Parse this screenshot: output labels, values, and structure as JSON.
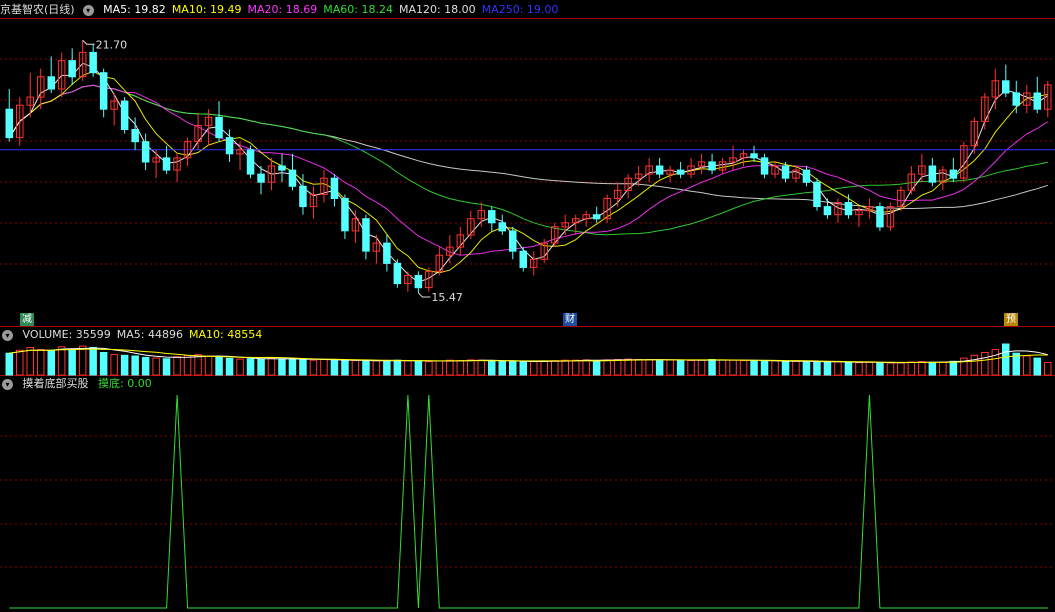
{
  "stock": {
    "name": "京基智农",
    "period": "(日线)"
  },
  "ma_legend": [
    {
      "label": "MA5: 19.82",
      "color": "#ffffff"
    },
    {
      "label": "MA10: 19.49",
      "color": "#ffff00"
    },
    {
      "label": "MA20: 18.69",
      "color": "#ff33ff"
    },
    {
      "label": "MA60: 18.24",
      "color": "#33dd33"
    },
    {
      "label": "MA120: 18.00",
      "color": "#dddddd"
    },
    {
      "label": "MA250: 19.00",
      "color": "#3333ff"
    }
  ],
  "volume_legend": [
    {
      "label": "VOLUME: 35599",
      "color": "#dddddd"
    },
    {
      "label": "MA5: 44896",
      "color": "#dddddd"
    },
    {
      "label": "MA10: 48554",
      "color": "#ffff00"
    }
  ],
  "indicator": {
    "name": "摸着底部买股",
    "series_label": "摸底: 0.00",
    "color": "#33dd33"
  },
  "price_labels": {
    "high": "21.70",
    "low": "15.47"
  },
  "events": [
    {
      "label": "减",
      "color": "#2e8b57"
    },
    {
      "label": "财",
      "color": "#1e4f9e"
    },
    {
      "label": "预",
      "color": "#b8860b"
    }
  ],
  "colors": {
    "up": "#ff3232",
    "down": "#54ffff",
    "grid": "#8b0000",
    "background": "#000000"
  },
  "chart_data": [
    {
      "type": "candlestick",
      "title": "京基智农 (日线)",
      "ylim": [
        15.0,
        22.2
      ],
      "ma_levels": {
        "MA5": 19.82,
        "MA10": 19.49,
        "MA20": 18.69,
        "MA60": 18.24,
        "MA120": 18.0,
        "MA250": 19.0
      },
      "high_marker": 21.7,
      "low_marker": 15.47,
      "candles": [
        {
          "o": 20.0,
          "h": 20.5,
          "l": 19.2,
          "c": 19.3
        },
        {
          "o": 19.3,
          "h": 20.3,
          "l": 19.1,
          "c": 20.1
        },
        {
          "o": 20.1,
          "h": 20.9,
          "l": 19.8,
          "c": 20.3
        },
        {
          "o": 20.3,
          "h": 21.0,
          "l": 20.0,
          "c": 20.8
        },
        {
          "o": 20.8,
          "h": 21.3,
          "l": 20.4,
          "c": 20.5
        },
        {
          "o": 20.5,
          "h": 21.4,
          "l": 20.3,
          "c": 21.2
        },
        {
          "o": 21.2,
          "h": 21.5,
          "l": 20.6,
          "c": 20.8
        },
        {
          "o": 20.8,
          "h": 21.7,
          "l": 20.7,
          "c": 21.4
        },
        {
          "o": 21.4,
          "h": 21.6,
          "l": 20.8,
          "c": 20.9
        },
        {
          "o": 20.9,
          "h": 21.0,
          "l": 19.8,
          "c": 20.0
        },
        {
          "o": 20.0,
          "h": 20.4,
          "l": 19.6,
          "c": 20.2
        },
        {
          "o": 20.2,
          "h": 20.3,
          "l": 19.4,
          "c": 19.5
        },
        {
          "o": 19.5,
          "h": 19.8,
          "l": 19.0,
          "c": 19.2
        },
        {
          "o": 19.2,
          "h": 19.4,
          "l": 18.5,
          "c": 18.7
        },
        {
          "o": 18.7,
          "h": 19.0,
          "l": 18.3,
          "c": 18.8
        },
        {
          "o": 18.8,
          "h": 19.1,
          "l": 18.4,
          "c": 18.5
        },
        {
          "o": 18.5,
          "h": 18.9,
          "l": 18.2,
          "c": 18.8
        },
        {
          "o": 18.8,
          "h": 19.3,
          "l": 18.6,
          "c": 19.2
        },
        {
          "o": 19.2,
          "h": 19.9,
          "l": 19.0,
          "c": 19.6
        },
        {
          "o": 19.6,
          "h": 20.0,
          "l": 19.1,
          "c": 19.8
        },
        {
          "o": 19.8,
          "h": 20.2,
          "l": 19.2,
          "c": 19.3
        },
        {
          "o": 19.3,
          "h": 19.5,
          "l": 18.7,
          "c": 18.9
        },
        {
          "o": 18.9,
          "h": 19.2,
          "l": 18.5,
          "c": 19.0
        },
        {
          "o": 19.0,
          "h": 19.1,
          "l": 18.3,
          "c": 18.4
        },
        {
          "o": 18.4,
          "h": 18.6,
          "l": 17.9,
          "c": 18.2
        },
        {
          "o": 18.2,
          "h": 18.8,
          "l": 18.0,
          "c": 18.6
        },
        {
          "o": 18.6,
          "h": 18.9,
          "l": 18.2,
          "c": 18.5
        },
        {
          "o": 18.5,
          "h": 18.9,
          "l": 18.0,
          "c": 18.1
        },
        {
          "o": 18.1,
          "h": 18.4,
          "l": 17.4,
          "c": 17.6
        },
        {
          "o": 17.6,
          "h": 18.1,
          "l": 17.3,
          "c": 17.9
        },
        {
          "o": 17.9,
          "h": 18.5,
          "l": 17.7,
          "c": 18.3
        },
        {
          "o": 18.3,
          "h": 18.4,
          "l": 17.6,
          "c": 17.8
        },
        {
          "o": 17.8,
          "h": 17.9,
          "l": 16.8,
          "c": 17.0
        },
        {
          "o": 17.0,
          "h": 17.5,
          "l": 16.7,
          "c": 17.3
        },
        {
          "o": 17.3,
          "h": 17.4,
          "l": 16.3,
          "c": 16.5
        },
        {
          "o": 16.5,
          "h": 16.9,
          "l": 16.2,
          "c": 16.7
        },
        {
          "o": 16.7,
          "h": 16.9,
          "l": 16.0,
          "c": 16.2
        },
        {
          "o": 16.2,
          "h": 16.3,
          "l": 15.6,
          "c": 15.7
        },
        {
          "o": 15.7,
          "h": 16.0,
          "l": 15.5,
          "c": 15.9
        },
        {
          "o": 15.9,
          "h": 16.0,
          "l": 15.47,
          "c": 15.6
        },
        {
          "o": 15.6,
          "h": 16.1,
          "l": 15.5,
          "c": 16.0
        },
        {
          "o": 16.0,
          "h": 16.6,
          "l": 15.9,
          "c": 16.4
        },
        {
          "o": 16.4,
          "h": 16.9,
          "l": 16.2,
          "c": 16.6
        },
        {
          "o": 16.6,
          "h": 17.1,
          "l": 16.4,
          "c": 16.9
        },
        {
          "o": 16.9,
          "h": 17.5,
          "l": 16.8,
          "c": 17.3
        },
        {
          "o": 17.3,
          "h": 17.7,
          "l": 17.1,
          "c": 17.5
        },
        {
          "o": 17.5,
          "h": 17.6,
          "l": 17.0,
          "c": 17.2
        },
        {
          "o": 17.2,
          "h": 17.4,
          "l": 16.9,
          "c": 17.0
        },
        {
          "o": 17.0,
          "h": 17.1,
          "l": 16.3,
          "c": 16.5
        },
        {
          "o": 16.5,
          "h": 16.6,
          "l": 16.0,
          "c": 16.1
        },
        {
          "o": 16.1,
          "h": 16.5,
          "l": 15.9,
          "c": 16.3
        },
        {
          "o": 16.3,
          "h": 16.8,
          "l": 16.2,
          "c": 16.7
        },
        {
          "o": 16.7,
          "h": 17.2,
          "l": 16.6,
          "c": 17.1
        },
        {
          "o": 17.1,
          "h": 17.4,
          "l": 16.9,
          "c": 17.2
        },
        {
          "o": 17.2,
          "h": 17.4,
          "l": 16.9,
          "c": 17.3
        },
        {
          "o": 17.3,
          "h": 17.5,
          "l": 17.1,
          "c": 17.4
        },
        {
          "o": 17.4,
          "h": 17.6,
          "l": 17.2,
          "c": 17.3
        },
        {
          "o": 17.3,
          "h": 17.9,
          "l": 17.2,
          "c": 17.8
        },
        {
          "o": 17.8,
          "h": 18.2,
          "l": 17.6,
          "c": 18.0
        },
        {
          "o": 18.0,
          "h": 18.4,
          "l": 17.8,
          "c": 18.3
        },
        {
          "o": 18.3,
          "h": 18.6,
          "l": 18.1,
          "c": 18.4
        },
        {
          "o": 18.4,
          "h": 18.8,
          "l": 18.2,
          "c": 18.6
        },
        {
          "o": 18.6,
          "h": 18.8,
          "l": 18.3,
          "c": 18.4
        },
        {
          "o": 18.4,
          "h": 18.6,
          "l": 18.2,
          "c": 18.5
        },
        {
          "o": 18.5,
          "h": 18.7,
          "l": 18.3,
          "c": 18.4
        },
        {
          "o": 18.4,
          "h": 18.8,
          "l": 18.3,
          "c": 18.6
        },
        {
          "o": 18.6,
          "h": 18.9,
          "l": 18.4,
          "c": 18.7
        },
        {
          "o": 18.7,
          "h": 18.9,
          "l": 18.4,
          "c": 18.5
        },
        {
          "o": 18.5,
          "h": 18.8,
          "l": 18.4,
          "c": 18.7
        },
        {
          "o": 18.7,
          "h": 19.1,
          "l": 18.5,
          "c": 18.8
        },
        {
          "o": 18.8,
          "h": 19.0,
          "l": 18.6,
          "c": 18.9
        },
        {
          "o": 18.9,
          "h": 19.1,
          "l": 18.7,
          "c": 18.8
        },
        {
          "o": 18.8,
          "h": 18.9,
          "l": 18.3,
          "c": 18.4
        },
        {
          "o": 18.4,
          "h": 18.7,
          "l": 18.3,
          "c": 18.6
        },
        {
          "o": 18.6,
          "h": 18.7,
          "l": 18.2,
          "c": 18.3
        },
        {
          "o": 18.3,
          "h": 18.6,
          "l": 18.2,
          "c": 18.5
        },
        {
          "o": 18.5,
          "h": 18.6,
          "l": 18.1,
          "c": 18.2
        },
        {
          "o": 18.2,
          "h": 18.3,
          "l": 17.5,
          "c": 17.6
        },
        {
          "o": 17.6,
          "h": 17.8,
          "l": 17.3,
          "c": 17.4
        },
        {
          "o": 17.4,
          "h": 17.8,
          "l": 17.2,
          "c": 17.7
        },
        {
          "o": 17.7,
          "h": 17.9,
          "l": 17.3,
          "c": 17.4
        },
        {
          "o": 17.4,
          "h": 17.6,
          "l": 17.1,
          "c": 17.5
        },
        {
          "o": 17.5,
          "h": 17.8,
          "l": 17.3,
          "c": 17.6
        },
        {
          "o": 17.6,
          "h": 17.7,
          "l": 17.0,
          "c": 17.1
        },
        {
          "o": 17.1,
          "h": 17.7,
          "l": 17.0,
          "c": 17.6
        },
        {
          "o": 17.6,
          "h": 18.1,
          "l": 17.5,
          "c": 18.0
        },
        {
          "o": 18.0,
          "h": 18.6,
          "l": 17.9,
          "c": 18.4
        },
        {
          "o": 18.4,
          "h": 18.9,
          "l": 18.2,
          "c": 18.6
        },
        {
          "o": 18.6,
          "h": 18.8,
          "l": 18.1,
          "c": 18.2
        },
        {
          "o": 18.2,
          "h": 18.6,
          "l": 18.0,
          "c": 18.5
        },
        {
          "o": 18.5,
          "h": 18.8,
          "l": 18.2,
          "c": 18.3
        },
        {
          "o": 18.3,
          "h": 19.2,
          "l": 18.2,
          "c": 19.1
        },
        {
          "o": 19.1,
          "h": 19.8,
          "l": 18.9,
          "c": 19.7
        },
        {
          "o": 19.7,
          "h": 20.4,
          "l": 19.5,
          "c": 20.3
        },
        {
          "o": 20.3,
          "h": 21.0,
          "l": 20.0,
          "c": 20.7
        },
        {
          "o": 20.7,
          "h": 21.1,
          "l": 20.3,
          "c": 20.4
        },
        {
          "o": 20.4,
          "h": 20.7,
          "l": 19.9,
          "c": 20.1
        },
        {
          "o": 20.1,
          "h": 20.6,
          "l": 19.9,
          "c": 20.4
        },
        {
          "o": 20.4,
          "h": 20.8,
          "l": 19.9,
          "c": 20.0
        },
        {
          "o": 20.0,
          "h": 20.7,
          "l": 19.8,
          "c": 20.6
        }
      ]
    },
    {
      "type": "bar",
      "title": "VOLUME",
      "volume_current": 35599,
      "volume_ma5": 44896,
      "volume_ma10": 48554,
      "values": [
        62000,
        70000,
        78000,
        72000,
        68000,
        80000,
        74000,
        82000,
        78000,
        64000,
        58000,
        56000,
        54000,
        50000,
        48000,
        46000,
        52000,
        55000,
        58000,
        54000,
        50000,
        47000,
        45000,
        46000,
        44000,
        48000,
        46000,
        45000,
        43000,
        42000,
        44000,
        42000,
        40000,
        41000,
        39000,
        40000,
        41000,
        42000,
        40000,
        39000,
        38000,
        40000,
        42000,
        41000,
        43000,
        42000,
        40000,
        39000,
        38000,
        37000,
        38000,
        40000,
        41000,
        42000,
        42000,
        43000,
        41000,
        43000,
        44000,
        45000,
        44000,
        43000,
        42000,
        43000,
        42000,
        41000,
        42000,
        44000,
        43000,
        42000,
        41000,
        40000,
        39000,
        40000,
        38000,
        39000,
        38000,
        37000,
        36000,
        37000,
        36000,
        35000,
        36000,
        35000,
        34000,
        35000,
        37000,
        38000,
        36000,
        37000,
        39000,
        48000,
        56000,
        64000,
        72000,
        88000,
        62000,
        54000,
        48000,
        35599
      ]
    },
    {
      "type": "line",
      "title": "摸着底部买股",
      "series": [
        {
          "name": "摸底",
          "values": [
            0,
            0,
            0,
            0,
            0,
            0,
            0,
            0,
            0,
            0,
            0,
            0,
            0,
            0,
            0,
            0,
            0,
            0,
            0,
            0,
            0,
            0,
            0,
            0,
            0,
            0,
            0,
            0,
            0,
            0,
            0,
            0,
            0,
            0,
            0,
            0,
            0,
            0,
            0,
            0,
            0,
            0,
            0,
            0,
            0,
            0,
            0,
            0,
            0,
            0,
            0,
            0,
            0,
            0,
            0,
            0,
            0,
            0,
            0,
            0,
            0,
            0,
            0,
            0,
            0,
            0,
            0,
            0,
            0,
            0,
            0,
            0,
            0,
            0,
            0,
            0,
            0,
            0,
            0,
            0,
            0,
            0,
            0,
            0,
            0,
            0,
            0,
            0,
            0,
            0,
            0,
            0,
            0,
            0,
            0,
            0,
            0,
            0,
            0,
            0
          ]
        }
      ],
      "signals": [
        {
          "index": 16,
          "value": 1
        },
        {
          "index": 38,
          "value": 1
        },
        {
          "index": 40,
          "value": 1
        },
        {
          "index": 82,
          "value": 1
        }
      ],
      "ylim": [
        0,
        1
      ]
    }
  ]
}
